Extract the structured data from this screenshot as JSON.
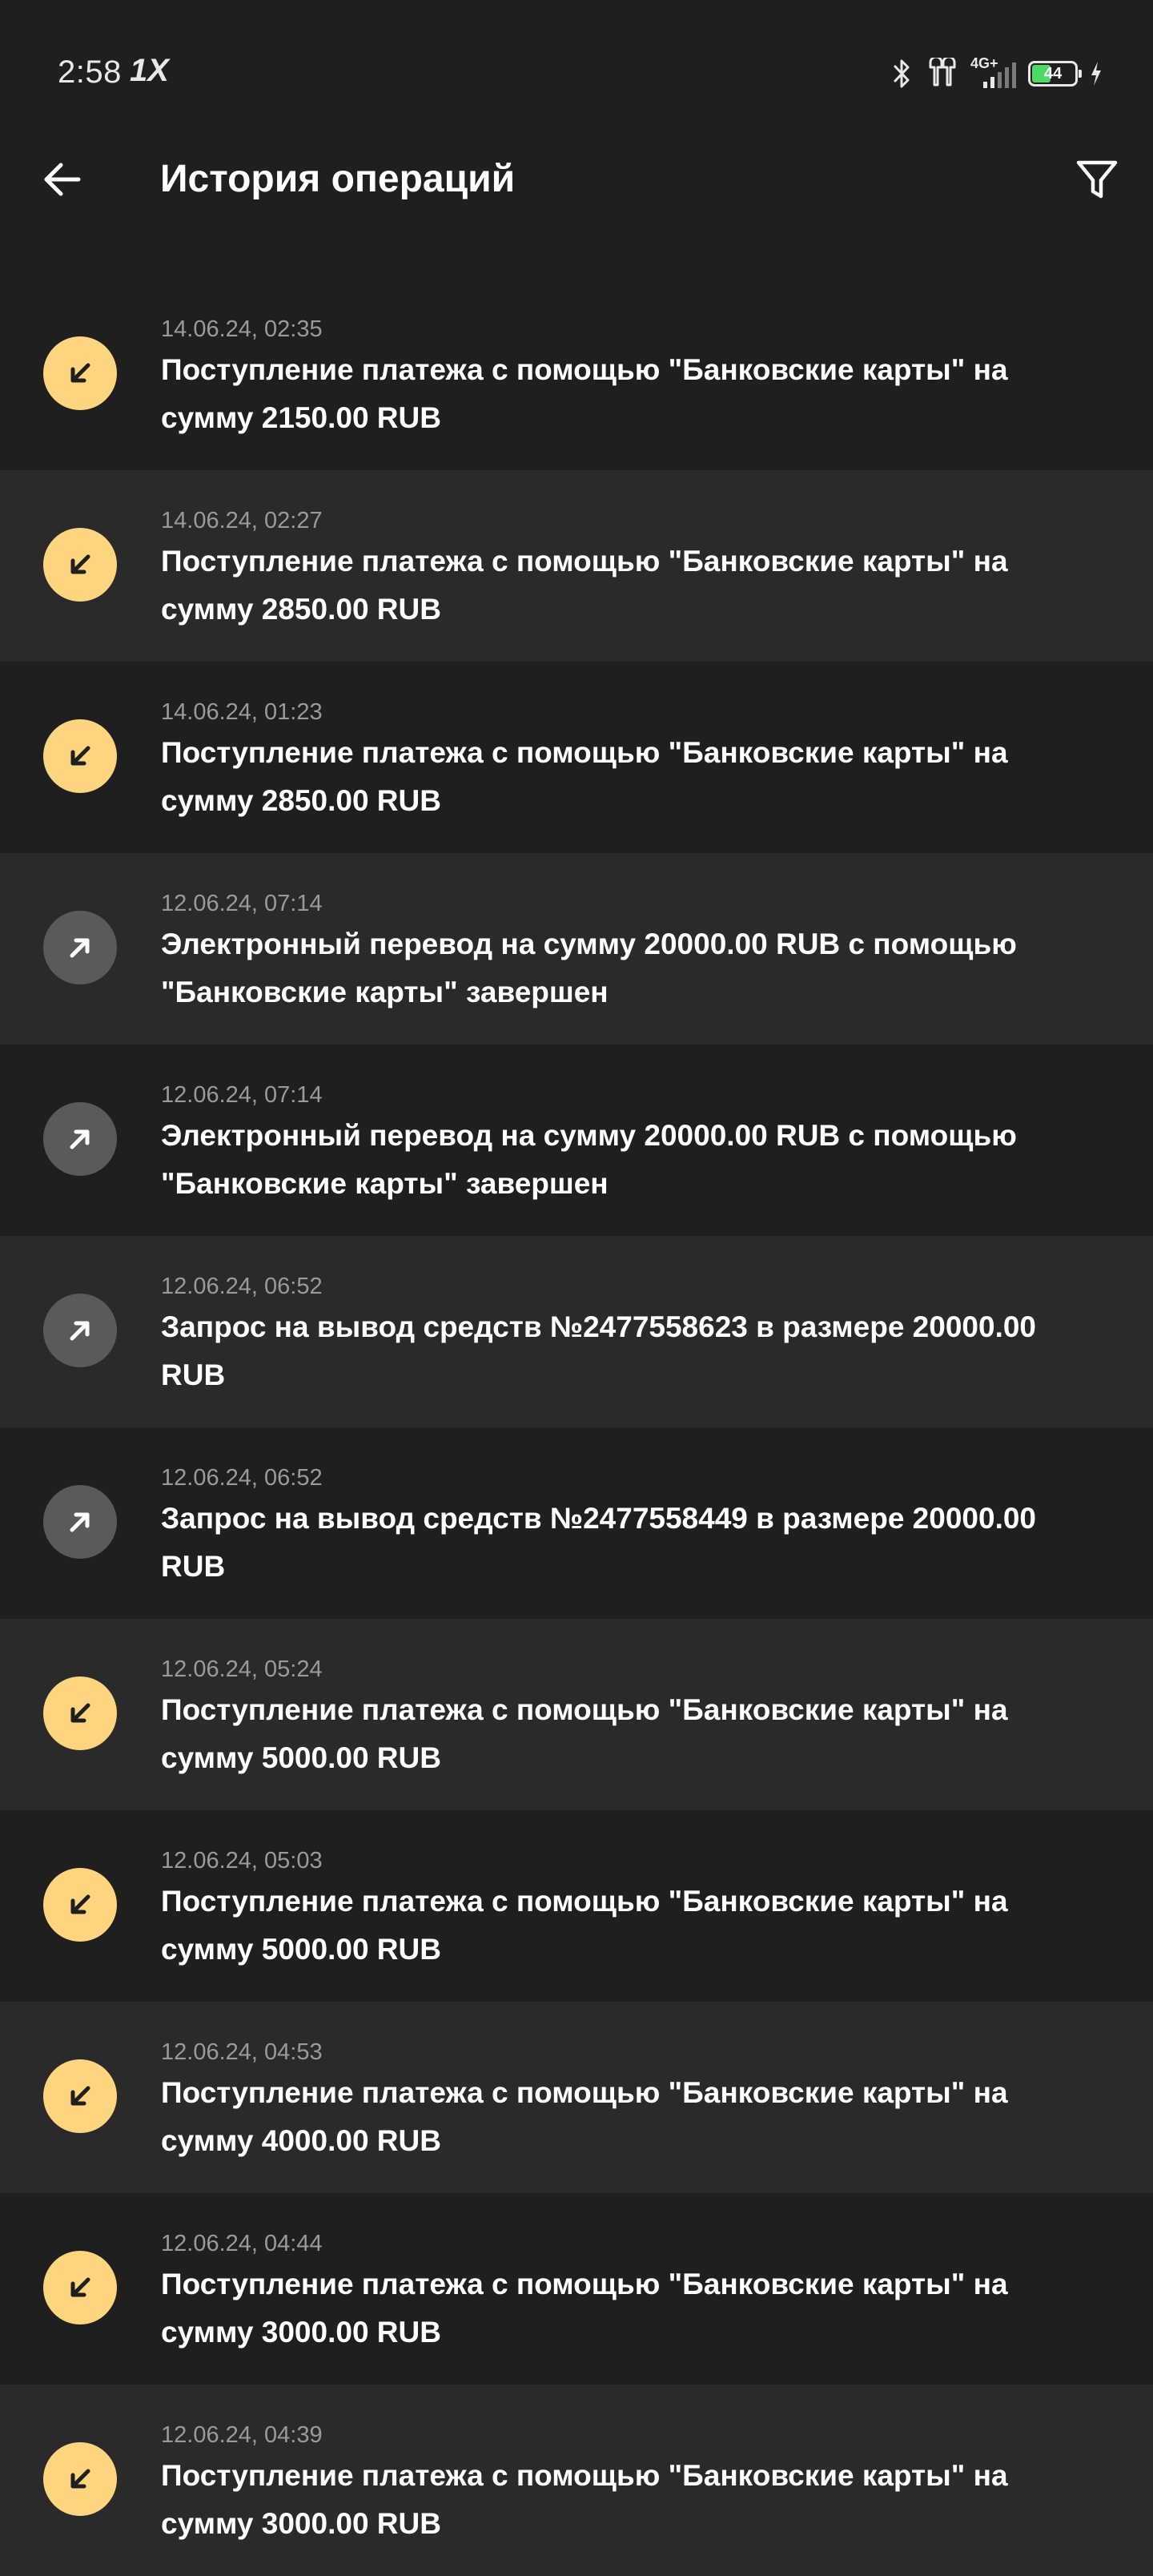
{
  "status_bar": {
    "time": "2:58",
    "brand": "1X",
    "network": "4G+",
    "battery_level": "44",
    "icons": [
      "bluetooth-icon",
      "earbuds-icon",
      "signal-icon",
      "battery-icon",
      "charging-icon"
    ]
  },
  "header": {
    "title": "История операций",
    "back_icon": "arrow-left-icon",
    "filter_icon": "filter-icon"
  },
  "colors": {
    "background": "#1f1f1f",
    "row_alt": "#2a2a2a",
    "incoming_icon_bg": "#fdd57e",
    "outgoing_icon_bg": "#5a5a5a",
    "date_text": "#9a9a9a"
  },
  "operations": [
    {
      "type": "incoming",
      "date": "14.06.24, 02:35",
      "text": "Поступление платежа с помощью \"Банковские карты\" на сумму 2150.00 RUB"
    },
    {
      "type": "incoming",
      "date": "14.06.24, 02:27",
      "text": "Поступление платежа с помощью \"Банковские карты\" на сумму 2850.00 RUB"
    },
    {
      "type": "incoming",
      "date": "14.06.24, 01:23",
      "text": "Поступление платежа с помощью \"Банковские карты\" на сумму 2850.00 RUB"
    },
    {
      "type": "outgoing",
      "date": "12.06.24, 07:14",
      "text": "Электронный перевод на сумму 20000.00 RUB с помощью \"Банковские карты\" завершен"
    },
    {
      "type": "outgoing",
      "date": "12.06.24, 07:14",
      "text": "Электронный перевод на сумму 20000.00 RUB с помощью \"Банковские карты\" завершен"
    },
    {
      "type": "outgoing",
      "date": "12.06.24, 06:52",
      "text": "Запрос на вывод средств №2477558623 в размере 20000.00 RUB"
    },
    {
      "type": "outgoing",
      "date": "12.06.24, 06:52",
      "text": "Запрос на вывод средств №2477558449 в размере 20000.00 RUB"
    },
    {
      "type": "incoming",
      "date": "12.06.24, 05:24",
      "text": "Поступление платежа с помощью \"Банковские карты\" на сумму 5000.00 RUB"
    },
    {
      "type": "incoming",
      "date": "12.06.24, 05:03",
      "text": "Поступление платежа с помощью \"Банковские карты\" на сумму 5000.00 RUB"
    },
    {
      "type": "incoming",
      "date": "12.06.24, 04:53",
      "text": "Поступление платежа с помощью \"Банковские карты\" на сумму 4000.00 RUB"
    },
    {
      "type": "incoming",
      "date": "12.06.24, 04:44",
      "text": "Поступление платежа с помощью \"Банковские карты\" на сумму 3000.00 RUB"
    },
    {
      "type": "incoming",
      "date": "12.06.24, 04:39",
      "text": "Поступление платежа с помощью \"Банковские карты\" на сумму 3000.00 RUB"
    }
  ]
}
